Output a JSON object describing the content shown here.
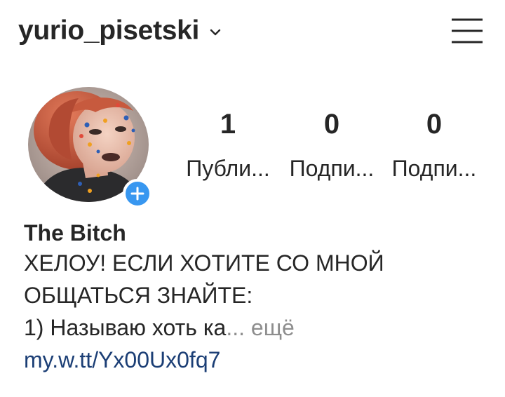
{
  "header": {
    "username": "yurio_pisetski",
    "chevron_icon": "chevron-down-icon",
    "menu_icon": "hamburger-menu-icon"
  },
  "profile": {
    "add_story_icon": "plus-icon",
    "accent_color": "#3897f0",
    "stats": [
      {
        "value": "1",
        "label": "Публи..."
      },
      {
        "value": "0",
        "label": "Подпи..."
      },
      {
        "value": "0",
        "label": "Подпи..."
      }
    ]
  },
  "bio": {
    "name": "The Bitch",
    "line1": "ХЕЛОУ! ЕСЛИ ХОТИТЕ СО МНОЙ",
    "line2": "ОБЩАТЬСЯ ЗНАЙТЕ:",
    "line3": "1) Называю хоть ка",
    "ellipsis": "...",
    "more": "ещё",
    "link": "my.w.tt/Yx00Ux0fq7",
    "link_color": "#1b3e75",
    "more_color": "#8e8e8e"
  }
}
